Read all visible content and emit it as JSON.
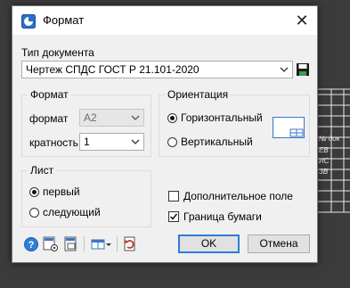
{
  "dialog": {
    "title": "Формат",
    "doc_type_label": "Тип документа",
    "doc_type_value": "Чертеж СПДС ГОСТ Р 21.101-2020",
    "format_group": {
      "title": "Формат",
      "format_label": "формат",
      "format_value": "A2",
      "multiplicity_label": "кратность",
      "multiplicity_value": "1"
    },
    "orientation_group": {
      "title": "Ориентация",
      "horizontal": "Горизонтальный",
      "vertical": "Вертикальный",
      "selected": "horizontal"
    },
    "sheet_group": {
      "title": "Лист",
      "first": "первый",
      "next": "следующий",
      "selected": "first"
    },
    "extra_field_label": "Дополнительное поле",
    "extra_field_checked": false,
    "paper_border_label": "Граница бумаги",
    "paper_border_checked": true,
    "ok_label": "OK",
    "cancel_label": "Отмена"
  },
  "background": {
    "cells": [
      "№ док",
      "ЕВ",
      "ИС",
      "ЗВ"
    ]
  }
}
